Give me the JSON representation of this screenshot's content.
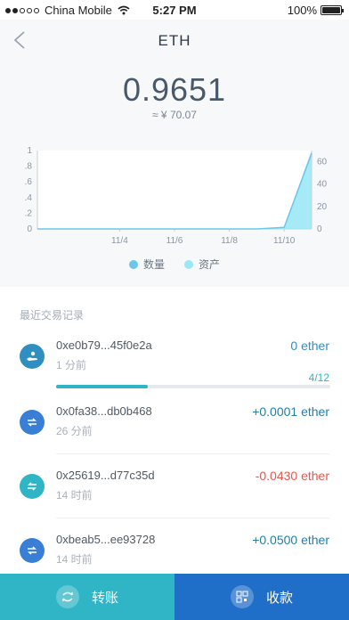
{
  "status_bar": {
    "carrier": "China Mobile",
    "time": "5:27 PM",
    "battery": "100%"
  },
  "header": {
    "title": "ETH",
    "balance": "0.9651",
    "fiat_value": "≈ ¥ 70.07"
  },
  "chart_data": {
    "type": "area",
    "x": [
      "11/4",
      "11/6",
      "11/8",
      "11/10"
    ],
    "left_axis_ticks": [
      "1",
      ".8",
      ".6",
      ".4",
      ".2",
      "0"
    ],
    "right_axis_ticks": [
      "60",
      "40",
      "20",
      "0"
    ],
    "left_ylim": [
      0,
      1
    ],
    "right_ylim": [
      0,
      70
    ],
    "series": [
      {
        "name": "数量",
        "color": "#6cc6ec",
        "axis": "left",
        "values": [
          0,
          0,
          0,
          0,
          0,
          0,
          0,
          0,
          0,
          0.02,
          0.9651
        ]
      },
      {
        "name": "资产",
        "color": "#9be8f5",
        "axis": "right",
        "values": [
          0,
          0,
          0,
          0,
          0,
          0,
          0,
          0,
          0,
          2,
          70.07
        ]
      }
    ],
    "x_points": [
      "11/1",
      "11/2",
      "11/3",
      "11/4",
      "11/5",
      "11/6",
      "11/7",
      "11/8",
      "11/9",
      "11/10",
      "11/11"
    ],
    "grid": false
  },
  "legend": {
    "quantity": "数量",
    "assets": "资产",
    "quantity_color": "#6cc6ec",
    "assets_color": "#9be8f5"
  },
  "transactions": {
    "title": "最近交易记录",
    "items": [
      {
        "address": "0xe0b79...45f0e2a",
        "time": "1 分前",
        "amount": "0 ether",
        "color": "#2f8fc0",
        "icon": "hand-coin-icon"
      },
      {
        "address": "0x0fa38...db0b468",
        "time": "26 分前",
        "amount": "+0.0001 ether",
        "color": "#1f7fa9",
        "icon": "receive-arrow-icon"
      },
      {
        "address": "0x25619...d77c35d",
        "time": "14 时前",
        "amount": "-0.0430 ether",
        "color": "#e0584f",
        "icon": "send-arrow-icon"
      },
      {
        "address": "0xbeab5...ee93728",
        "time": "14 时前",
        "amount": "+0.0500 ether",
        "color": "#1f7fa9",
        "icon": "receive-arrow-icon"
      }
    ],
    "progress": {
      "label": "4/12",
      "fraction": 0.333
    }
  },
  "bottom_bar": {
    "transfer": "转账",
    "receive": "收款"
  }
}
